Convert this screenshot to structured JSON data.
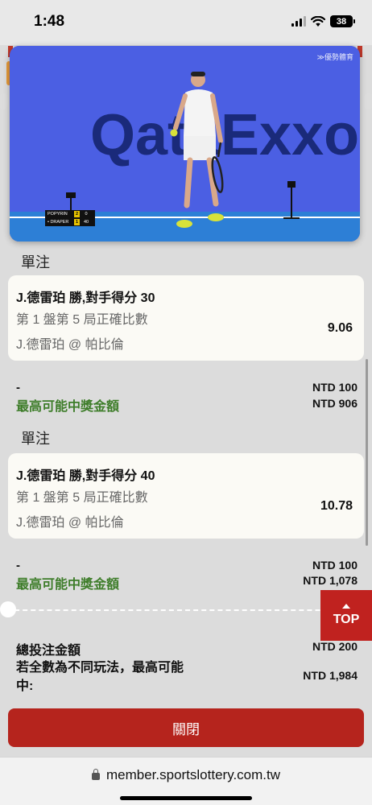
{
  "status_bar": {
    "time": "1:48",
    "battery": "38"
  },
  "video": {
    "watermark": "≫優勢體育",
    "banner_text_left": "Qata",
    "banner_text_right": "Exxon",
    "score": [
      {
        "player": "POPYRIN",
        "sets": "2",
        "points": "0"
      },
      {
        "player": "• DRAPER",
        "sets": "1",
        "points": "40"
      }
    ]
  },
  "bets": [
    {
      "section_label": "單注",
      "title": "J.德雷珀 勝,對手得分 30",
      "market": "第 1 盤第 5 局正確比數",
      "event": "J.德雷珀 @ 帕比倫",
      "odds": "9.06",
      "stake_dash": "-",
      "stake": "NTD 100",
      "max_win_label": "最高可能中獎金額",
      "max_win": "NTD 906"
    },
    {
      "section_label": "單注",
      "title": "J.德雷珀 勝,對手得分 40",
      "market": "第 1 盤第 5 局正確比數",
      "event": "J.德雷珀 @ 帕比倫",
      "odds": "10.78",
      "stake_dash": "-",
      "stake": "NTD 100",
      "max_win_label": "最高可能中獎金額",
      "max_win": "NTD 1,078"
    }
  ],
  "summary": {
    "total_label": "總投注金額",
    "total_amount": "NTD 200",
    "combo_label": "若全數為不同玩法，最高可能中:",
    "combo_amount": "NTD 1,984"
  },
  "top_button": "TOP",
  "close_button": "關閉",
  "url": "member.sportslottery.com.tw",
  "colors": {
    "accent_red": "#c0221f",
    "win_green": "#3e7d2a"
  }
}
